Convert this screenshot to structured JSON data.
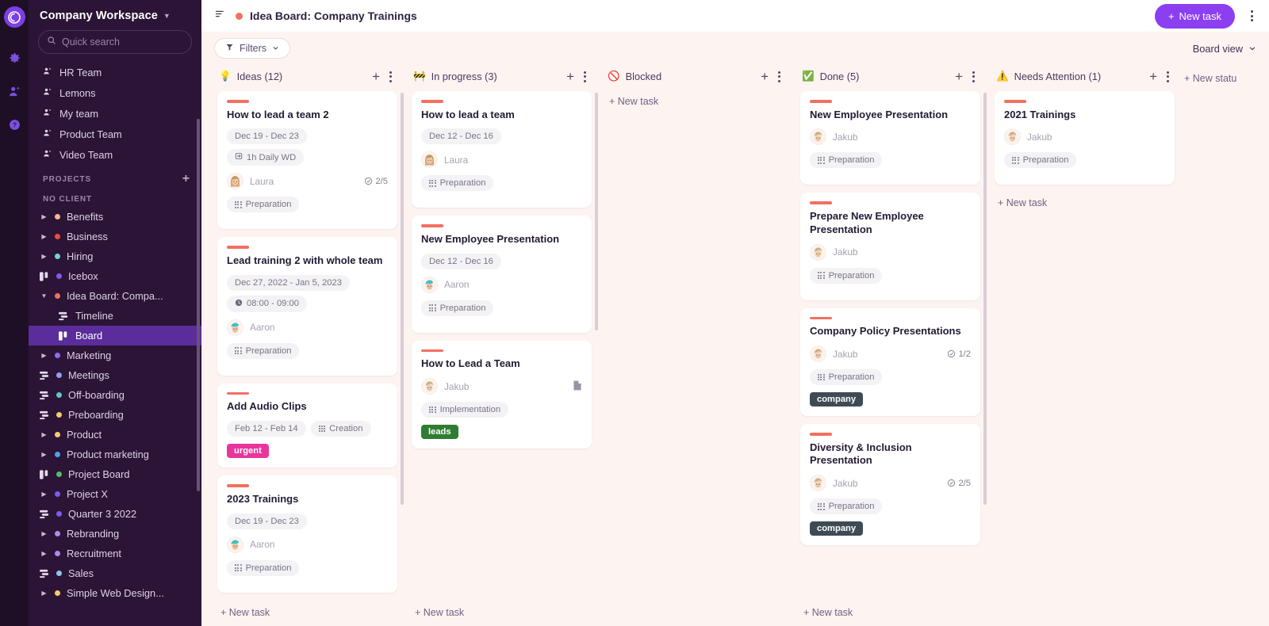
{
  "rail": {
    "logo": "app-logo",
    "icons": [
      "gear-icon",
      "add-user-icon",
      "help-icon"
    ]
  },
  "sidebar": {
    "workspace": "Company Workspace",
    "search_placeholder": "Quick search",
    "teams": [
      {
        "label": "HR Team"
      },
      {
        "label": "Lemons"
      },
      {
        "label": "My team"
      },
      {
        "label": "Product Team"
      },
      {
        "label": "Video Team"
      }
    ],
    "projects_header": "PROJECTS",
    "no_client_label": "NO CLIENT",
    "projects": [
      {
        "label": "Benefits",
        "color": "#f5b78a",
        "kind": "arrow",
        "indent": false,
        "active": false
      },
      {
        "label": "Business",
        "color": "#ef4d3a",
        "kind": "arrow",
        "indent": false,
        "active": false
      },
      {
        "label": "Hiring",
        "color": "#6ed4d6",
        "kind": "arrow",
        "indent": false,
        "active": false
      },
      {
        "label": "Icebox",
        "color": "#7b5cf0",
        "kind": "board",
        "indent": false,
        "active": false
      },
      {
        "label": "Idea Board: Compa...",
        "color": "#f2705f",
        "kind": "arrow-down",
        "indent": false,
        "active": false
      },
      {
        "label": "Timeline",
        "color": "",
        "kind": "timeline",
        "indent": true,
        "active": false
      },
      {
        "label": "Board",
        "color": "",
        "kind": "board",
        "indent": true,
        "active": true
      },
      {
        "label": "Marketing",
        "color": "#8b6ef0",
        "kind": "arrow",
        "indent": false,
        "active": false
      },
      {
        "label": "Meetings",
        "color": "#8ba3f0",
        "kind": "timeline",
        "indent": false,
        "active": false
      },
      {
        "label": "Off-boarding",
        "color": "#5fc9c0",
        "kind": "timeline",
        "indent": false,
        "active": false
      },
      {
        "label": "Preboarding",
        "color": "#f5cc6a",
        "kind": "timeline",
        "indent": false,
        "active": false
      },
      {
        "label": "Product",
        "color": "#f5cc6a",
        "kind": "arrow",
        "indent": false,
        "active": false
      },
      {
        "label": "Product marketing",
        "color": "#4aa3f0",
        "kind": "arrow",
        "indent": false,
        "active": false
      },
      {
        "label": "Project Board",
        "color": "#4fbd6e",
        "kind": "board",
        "indent": false,
        "active": false
      },
      {
        "label": "Project X",
        "color": "#7b5cf0",
        "kind": "arrow",
        "indent": false,
        "active": false
      },
      {
        "label": "Quarter 3 2022",
        "color": "#7b5cf0",
        "kind": "timeline",
        "indent": false,
        "active": false
      },
      {
        "label": "Rebranding",
        "color": "#a88cf0",
        "kind": "arrow",
        "indent": false,
        "active": false
      },
      {
        "label": "Recruitment",
        "color": "#a88cf0",
        "kind": "arrow",
        "indent": false,
        "active": false
      },
      {
        "label": "Sales",
        "color": "#8fc4ef",
        "kind": "timeline",
        "indent": false,
        "active": false
      },
      {
        "label": "Simple Web Design...",
        "color": "#f5cc6a",
        "kind": "arrow",
        "indent": false,
        "active": false
      }
    ]
  },
  "topbar": {
    "board_title": "Idea Board: Company Trainings",
    "board_dot_color": "#f2705f",
    "new_task_label": "New task",
    "new_task_plus": "+",
    "menu_icon": "kebab-menu-icon",
    "sort_icon": "sort-icon"
  },
  "subbar": {
    "filters_label": "Filters",
    "board_view_label": "Board view"
  },
  "board": {
    "new_task_label": "+ New task",
    "new_status_label": "+ New statu",
    "columns": [
      {
        "id": "ideas",
        "icon": "💡",
        "title": "Ideas (12)",
        "cards": [
          {
            "title": "How to lead a team 2",
            "chips": [
              {
                "text": "Dec 19 - Dec 23",
                "icon": ""
              },
              {
                "text": "1h Daily WD",
                "icon": "repeat-icon"
              }
            ],
            "assignee": "Laura",
            "avatar": "laura",
            "subcount": "2/5",
            "tags": [],
            "board_chip": "Preparation",
            "doc": false
          },
          {
            "title": "Lead training 2 with whole team",
            "chips": [
              {
                "text": "Dec 27, 2022 - Jan 5, 2023",
                "icon": ""
              },
              {
                "text": "08:00 - 09:00",
                "icon": "clock-icon"
              }
            ],
            "assignee": "Aaron",
            "avatar": "aaron",
            "subcount": "",
            "tags": [],
            "board_chip": "Preparation",
            "doc": false
          },
          {
            "title": "Add Audio Clips",
            "chips": [
              {
                "text": "Feb 12 - Feb 14",
                "icon": ""
              },
              {
                "text": "Creation",
                "icon": "grid-icon"
              }
            ],
            "assignee": "",
            "avatar": "",
            "subcount": "",
            "tags": [
              {
                "text": "urgent",
                "color": "#e8359c"
              }
            ],
            "board_chip": "",
            "doc": false
          },
          {
            "title": "2023 Trainings",
            "chips": [
              {
                "text": "Dec 19 - Dec 23",
                "icon": ""
              }
            ],
            "assignee": "Aaron",
            "avatar": "aaron",
            "subcount": "",
            "tags": [],
            "board_chip": "Preparation",
            "doc": false
          }
        ]
      },
      {
        "id": "in-progress",
        "icon": "🚧",
        "title": "In progress (3)",
        "cards": [
          {
            "title": "How to lead a team",
            "chips": [
              {
                "text": "Dec 12 - Dec 16",
                "icon": ""
              }
            ],
            "assignee": "Laura",
            "avatar": "laura",
            "subcount": "",
            "tags": [],
            "board_chip": "Preparation",
            "doc": false
          },
          {
            "title": "New Employee Presentation",
            "chips": [
              {
                "text": "Dec 12 - Dec 16",
                "icon": ""
              }
            ],
            "assignee": "Aaron",
            "avatar": "aaron",
            "subcount": "",
            "tags": [],
            "board_chip": "Preparation",
            "doc": false
          },
          {
            "title": "How to Lead a Team",
            "chips": [],
            "assignee": "Jakub",
            "avatar": "jakub",
            "subcount": "",
            "tags": [
              {
                "text": "leads",
                "color": "#2f7d32"
              }
            ],
            "board_chip": "Implementation",
            "doc": true
          }
        ]
      },
      {
        "id": "blocked",
        "icon": "🚫",
        "title": "Blocked",
        "cards": []
      },
      {
        "id": "done",
        "icon": "✅",
        "title": "Done (5)",
        "cards": [
          {
            "title": "New Employee Presentation",
            "chips": [],
            "assignee": "Jakub",
            "avatar": "jakub",
            "subcount": "",
            "tags": [],
            "board_chip": "Preparation",
            "doc": false
          },
          {
            "title": "Prepare New Employee Presentation",
            "chips": [],
            "assignee": "Jakub",
            "avatar": "jakub",
            "subcount": "",
            "tags": [],
            "board_chip": "Preparation",
            "doc": false
          },
          {
            "title": "Company Policy Presentations",
            "chips": [],
            "assignee": "Jakub",
            "avatar": "jakub",
            "subcount": "1/2",
            "tags": [
              {
                "text": "company",
                "color": "#3e4b55"
              }
            ],
            "board_chip": "Preparation",
            "doc": false
          },
          {
            "title": "Diversity & Inclusion Presentation",
            "chips": [],
            "assignee": "Jakub",
            "avatar": "jakub",
            "subcount": "2/5",
            "tags": [
              {
                "text": "company",
                "color": "#3e4b55"
              }
            ],
            "board_chip": "Preparation",
            "doc": false
          }
        ]
      },
      {
        "id": "needs-attention",
        "icon": "⚠️",
        "title": "Needs Attention (1)",
        "cards": [
          {
            "title": "2021 Trainings",
            "chips": [],
            "assignee": "Jakub",
            "avatar": "jakub",
            "subcount": "",
            "tags": [],
            "board_chip": "Preparation",
            "doc": false
          }
        ]
      }
    ]
  }
}
